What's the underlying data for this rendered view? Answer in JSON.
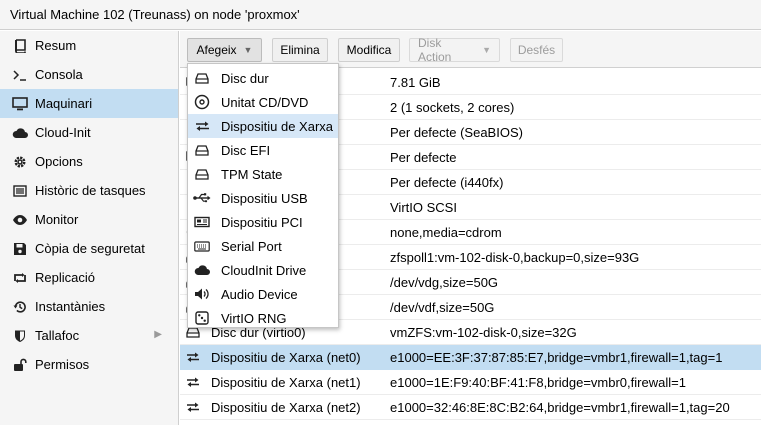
{
  "window": {
    "title": "Virtual Machine 102 (Treunass) on node 'proxmox'"
  },
  "sidebar": {
    "items": [
      {
        "label": "Resum",
        "icon": "book-icon"
      },
      {
        "label": "Consola",
        "icon": "terminal-icon"
      },
      {
        "label": "Maquinari",
        "icon": "monitor-icon",
        "active": true
      },
      {
        "label": "Cloud-Init",
        "icon": "cloud-icon"
      },
      {
        "label": "Opcions",
        "icon": "gear-icon"
      },
      {
        "label": "Històric de tasques",
        "icon": "list-icon"
      },
      {
        "label": "Monitor",
        "icon": "eye-icon"
      },
      {
        "label": "Còpia de seguretat",
        "icon": "floppy-icon"
      },
      {
        "label": "Replicació",
        "icon": "retweet-icon"
      },
      {
        "label": "Instantànies",
        "icon": "history-icon"
      },
      {
        "label": "Tallafoc",
        "icon": "shield-icon",
        "has_children": true
      },
      {
        "label": "Permisos",
        "icon": "unlock-icon"
      }
    ]
  },
  "toolbar": {
    "add_label": "Afegeix",
    "remove_label": "Elimina",
    "edit_label": "Modifica",
    "disk_action_label": "Disk Action",
    "revert_label": "Desfés"
  },
  "add_menu": {
    "items": [
      {
        "label": "Disc dur",
        "icon": "hdd-icon"
      },
      {
        "label": "Unitat CD/DVD",
        "icon": "cdrom-icon"
      },
      {
        "label": "Dispositiu de Xarxa",
        "icon": "network-exchange-icon",
        "hover": true
      },
      {
        "label": "Disc EFI",
        "icon": "hdd-icon"
      },
      {
        "label": "TPM State",
        "icon": "hdd-icon"
      },
      {
        "label": "Dispositiu USB",
        "icon": "usb-icon"
      },
      {
        "label": "Dispositiu PCI",
        "icon": "pci-card-icon"
      },
      {
        "label": "Serial Port",
        "icon": "keyboard-icon"
      },
      {
        "label": "CloudInit Drive",
        "icon": "cloud-icon"
      },
      {
        "label": "Audio Device",
        "icon": "volume-icon"
      },
      {
        "label": "VirtIO RNG",
        "icon": "dice-icon"
      }
    ]
  },
  "hardware": {
    "rows": [
      {
        "key": "",
        "value": "7.81 GiB",
        "icon": "memory-icon"
      },
      {
        "key": "",
        "value": "2 (1 sockets, 2 cores)",
        "icon": "cpu-icon"
      },
      {
        "key": "",
        "value": "Per defecte (SeaBIOS)",
        "icon": "chip-icon"
      },
      {
        "key": "",
        "value": "Per defecte",
        "icon": "display-icon"
      },
      {
        "key": "",
        "value": "Per defecte (i440fx)",
        "icon": "cogs-icon"
      },
      {
        "key": "",
        "value": "VirtIO SCSI",
        "icon": "database-icon"
      },
      {
        "key": "",
        "value": "none,media=cdrom",
        "icon": "cdrom-icon"
      },
      {
        "key": "",
        "value": "zfspoll1:vm-102-disk-0,backup=0,size=93G",
        "icon": "hdd-icon"
      },
      {
        "key": "",
        "value": "/dev/vdg,size=50G",
        "icon": "hdd-icon"
      },
      {
        "key": "",
        "value": "/dev/vdf,size=50G",
        "icon": "hdd-icon"
      },
      {
        "key": "Disc dur (virtio0)",
        "value": "vmZFS:vm-102-disk-0,size=32G",
        "icon": "hdd-icon"
      },
      {
        "key": "Dispositiu de Xarxa (net0)",
        "value": "e1000=EE:3F:37:87:85:E7,bridge=vmbr1,firewall=1,tag=1",
        "icon": "network-exchange-icon",
        "selected": true
      },
      {
        "key": "Dispositiu de Xarxa (net1)",
        "value": "e1000=1E:F9:40:BF:41:F8,bridge=vmbr0,firewall=1",
        "icon": "network-exchange-icon"
      },
      {
        "key": "Dispositiu de Xarxa (net2)",
        "value": "e1000=32:46:8E:8C:B2:64,bridge=vmbr1,firewall=1,tag=20",
        "icon": "network-exchange-icon"
      }
    ]
  },
  "colors": {
    "selected": "#c2ddf2",
    "menu_hover": "#d6e7f7",
    "panel": "#f5f5f5"
  }
}
